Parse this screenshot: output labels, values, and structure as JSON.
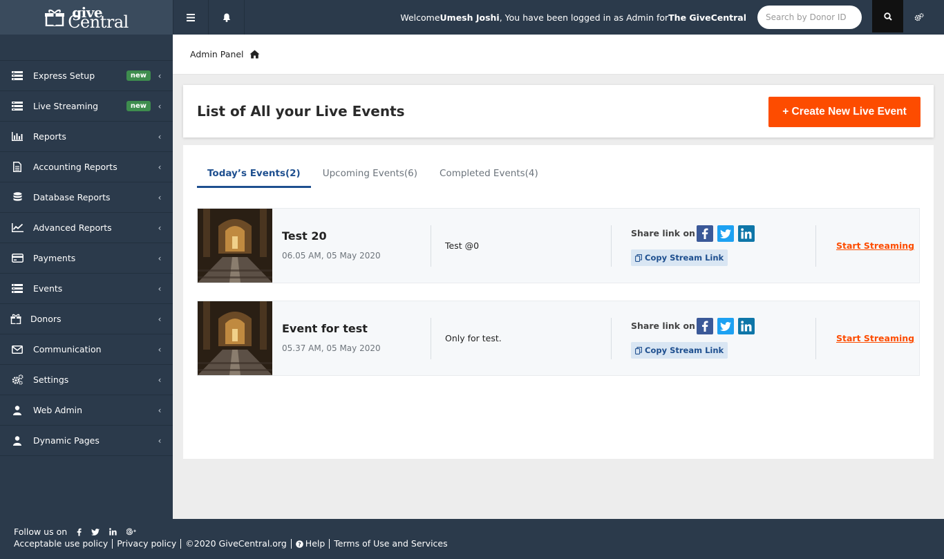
{
  "brand": {
    "logo_top": "give",
    "logo_bottom": "Central"
  },
  "header": {
    "welcome_prefix": "Welcome ",
    "user_name": "Umesh Joshi",
    "welcome_middle": ", You have been logged in as Admin for ",
    "org_name": "The GiveCentral",
    "search_placeholder": "Search by Donor ID"
  },
  "sidebar": {
    "items": [
      {
        "label": "Express Setup",
        "icon": "list-icon",
        "badge": "new"
      },
      {
        "label": "Live Streaming",
        "icon": "list-icon",
        "badge": "new"
      },
      {
        "label": "Reports",
        "icon": "bar-chart-icon"
      },
      {
        "label": "Accounting Reports",
        "icon": "document-icon"
      },
      {
        "label": "Database Reports",
        "icon": "database-icon"
      },
      {
        "label": "Advanced Reports",
        "icon": "line-chart-icon"
      },
      {
        "label": "Payments",
        "icon": "credit-card-icon"
      },
      {
        "label": "Events",
        "icon": "list-icon"
      },
      {
        "label": "Donors",
        "icon": "gift-icon"
      },
      {
        "label": "Communication",
        "icon": "envelope-icon"
      },
      {
        "label": "Settings",
        "icon": "cogs-icon"
      },
      {
        "label": "Web Admin",
        "icon": "user-icon"
      },
      {
        "label": "Dynamic Pages",
        "icon": "user-icon"
      }
    ]
  },
  "breadcrumb": {
    "label": "Admin Panel",
    "icon": "home-icon"
  },
  "main": {
    "title": "List of All your Live Events",
    "create_button": "+ Create New Live Event",
    "tabs": [
      {
        "label": "Today’s Events(2)",
        "active": true
      },
      {
        "label": "Upcoming Events(6)",
        "active": false
      },
      {
        "label": "Completed Events(4)",
        "active": false
      }
    ],
    "events": [
      {
        "name": "Test 20",
        "datetime": "06.05 AM, 05 May 2020",
        "description": "Test @0",
        "share_label": "Share link on :",
        "copy_label": "Copy Stream Link",
        "action_label": "Start Streaming"
      },
      {
        "name": "Event for test",
        "datetime": "05.37 AM, 05 May 2020",
        "description": "Only for test.",
        "share_label": "Share link on :",
        "copy_label": "Copy Stream Link",
        "action_label": "Start Streaming"
      }
    ]
  },
  "footer": {
    "follow_label": "Follow us on",
    "social_icons": [
      "facebook-icon",
      "twitter-icon",
      "linkedin-icon",
      "google-plus-icon"
    ],
    "links": [
      "Acceptable use policy",
      "Privacy policy",
      "©2020 GiveCentral.org",
      "Help",
      "Terms of Use and Services"
    ]
  },
  "colors": {
    "navy": "#2b3a4b",
    "accent_orange": "#fd4c00",
    "tab_blue": "#1e4f8f",
    "badge_green": "#3e8d4e",
    "facebook": "#3b5998",
    "twitter": "#1da1f2",
    "linkedin": "#0e76a8"
  }
}
